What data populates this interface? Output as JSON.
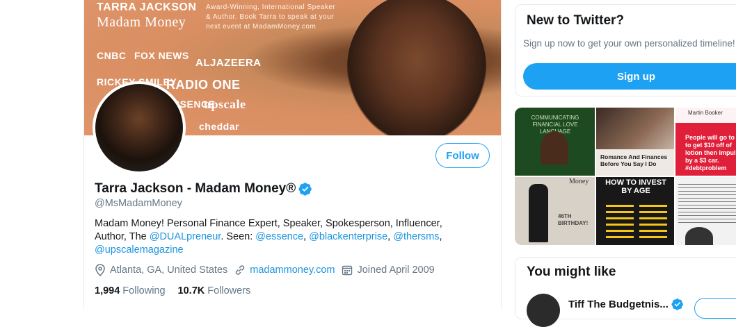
{
  "banner": {
    "brand": "TARRA JACKSON",
    "brand_sub": "Madam Money",
    "promo": "Award-Winning, International Speaker & Author. Book Tarra to speak at your next event at MadamMoney.com",
    "logos": [
      "CNBC",
      "FOX NEWS",
      "ALJAZEERA",
      "RICKEY SMILEY",
      "RADIO ONE",
      "ESSENCE",
      "upscale",
      "cheddar"
    ]
  },
  "profile": {
    "name": "Tarra Jackson - Madam Money®",
    "handle": "@MsMadamMoney",
    "follow_label": "Follow",
    "bio_text_1": "Madam Money! Personal Finance Expert, Speaker, Spokesperson, Influencer, Author, The ",
    "bio_link_1": "@DUALpreneur",
    "bio_text_2": ". Seen: ",
    "bio_link_2": "@essence",
    "bio_sep_1": ", ",
    "bio_link_3": "@blackenterprise",
    "bio_sep_2": ", ",
    "bio_link_4": "@thersms",
    "bio_sep_3": ",",
    "bio_link_5": "@upscalemagazine",
    "location": "Atlanta, GA, United States",
    "website": "madammoney.com",
    "joined": "Joined April 2009",
    "following_count": "1,994",
    "following_label": "Following",
    "followers_count": "10.7K",
    "followers_label": "Followers"
  },
  "sidebar": {
    "signup_title": "New to Twitter?",
    "signup_desc": "Sign up now to get your own personalized timeline!",
    "signup_button": "Sign up",
    "media_captions": {
      "tile1": "COMMUNICATING FINANCIAL LOVE LANGUAGE",
      "tile2": "Romance And Finances Before You Say I Do",
      "tile3_author": "Martin Booker",
      "tile3_text": "People will go to $ to get $10 off of lotion then impulse by a $3 car. #debtproblem",
      "tile4_text": "46TH BIRTHDAY!",
      "tile5_text": "HOW TO INVEST BY AGE",
      "tile4_top": "Money"
    },
    "like_title": "You might like",
    "like_name": "Tiff The Budgetnis..."
  },
  "colors": {
    "accent": "#1da1f2",
    "link": "#1b95e0",
    "muted": "#657786"
  }
}
